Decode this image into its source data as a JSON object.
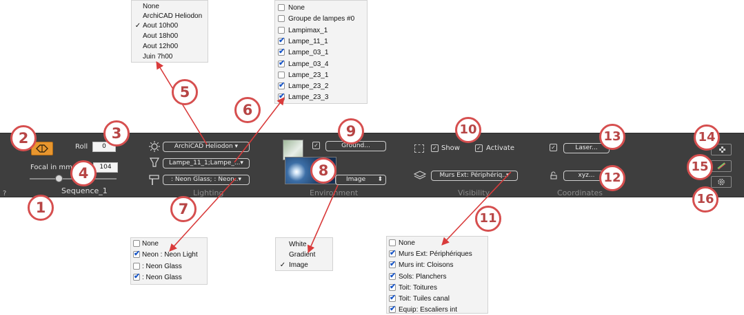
{
  "toolbar": {
    "help": "?",
    "camera": {
      "roll_label": "Roll",
      "roll_value": "0",
      "focal_label": "Focal in mm",
      "focal_value": "104",
      "sequence": "Sequence_1"
    },
    "lighting": {
      "section": "Lighting",
      "sun_button": "ArchiCAD Heliodon ▾",
      "lamps_button": "Lampe_11_1;Lampe_...▾",
      "neon_button": ": Neon Glass; : Neon..▾"
    },
    "environment": {
      "section": "Environment",
      "ground_button": "Ground...",
      "ground_checked": true,
      "background_select": "Image",
      "select_arrows": "⬍"
    },
    "visibility": {
      "section": "Visibility",
      "show_label": "Show",
      "show_checked": true,
      "activate_label": "Activate",
      "activate_checked": true,
      "layers_button": "Murs Ext: Périphériq..▾"
    },
    "coordinates": {
      "section": "Coordinates",
      "laser_button": "Laser...",
      "laser_checked": true,
      "xyz_button": "xyz..."
    }
  },
  "menus": {
    "sun": [
      "None",
      "ArchiCAD Heliodon",
      "Aout 10h00",
      "Aout 18h00",
      "Aout 12h00",
      "Juin 7h00"
    ],
    "sun_checkmark": "✓",
    "lamps": [
      {
        "label": "None",
        "checked": false
      },
      {
        "label": "Groupe de lampes #0",
        "checked": false
      },
      {
        "label": "Lampimax_1",
        "checked": false
      },
      {
        "label": "Lampe_11_1",
        "checked": true
      },
      {
        "label": "Lampe_03_1",
        "checked": true
      },
      {
        "label": "Lampe_03_4",
        "checked": true
      },
      {
        "label": "Lampe_23_1",
        "checked": false
      },
      {
        "label": "Lampe_23_2",
        "checked": true
      },
      {
        "label": "Lampe_23_3",
        "checked": true
      }
    ],
    "neon": [
      {
        "label": "None",
        "checked": false
      },
      {
        "label": "Neon : Neon Light",
        "checked": true
      },
      {
        "label": " : Neon Glass",
        "checked": false
      },
      {
        "label": " : Neon Glass",
        "checked": true
      }
    ],
    "background": [
      "White",
      "Gradient",
      "Image"
    ],
    "background_checkmark": "✓",
    "layers": [
      {
        "label": "None",
        "checked": false
      },
      {
        "label": "Murs Ext: Périphériques",
        "checked": true
      },
      {
        "label": "Murs int: Cloisons",
        "checked": true
      },
      {
        "label": "Sols: Planchers",
        "checked": true
      },
      {
        "label": "Toit: Toitures",
        "checked": true
      },
      {
        "label": "Toit: Tuiles canal",
        "checked": true
      },
      {
        "label": "Equip: Escaliers int",
        "checked": true
      }
    ]
  },
  "callouts": [
    "1",
    "2",
    "3",
    "4",
    "5",
    "6",
    "7",
    "8",
    "9",
    "10",
    "11",
    "12",
    "13",
    "14",
    "15",
    "16"
  ],
  "colors": {
    "toolbar_bg": "#3e3e3e",
    "callout_ring": "#d64f4f",
    "callout_text": "#b74545",
    "arrow": "#d93b3b",
    "checkbox_blue": "#1a57c8",
    "camera_icon_bg": "#e8962e"
  }
}
